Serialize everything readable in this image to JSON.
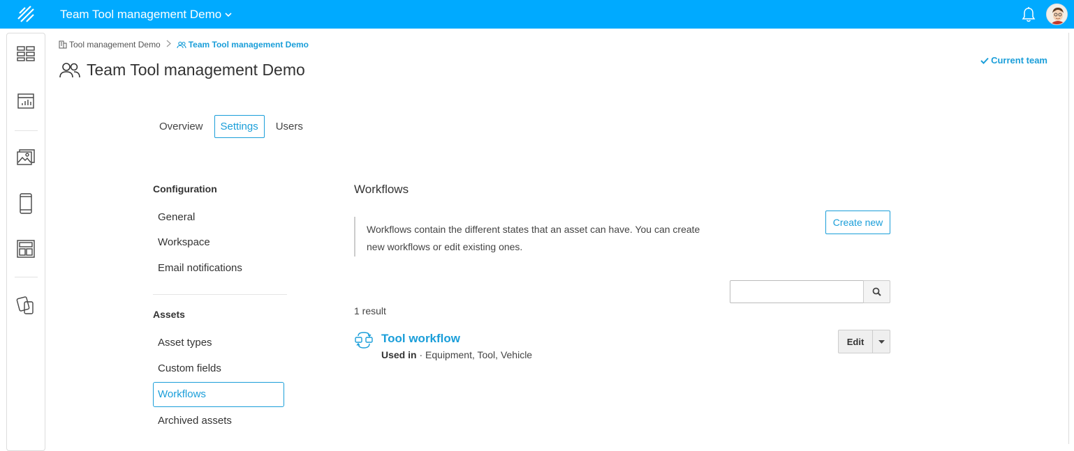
{
  "topbar": {
    "title": "Team Tool management Demo",
    "title_chevron": "⌄",
    "icons": [
      "logo-icon",
      "bell-icon",
      "avatar"
    ]
  },
  "breadcrumb": {
    "items": [
      {
        "label": "Tool management Demo",
        "icon": "building-icon"
      },
      {
        "label": "Team Tool management Demo",
        "icon": "team-icon"
      }
    ]
  },
  "page": {
    "title": "Team Tool management Demo",
    "current_team": "Current team"
  },
  "tabs": [
    {
      "label": "Overview",
      "active": false
    },
    {
      "label": "Settings",
      "active": true
    },
    {
      "label": "Users",
      "active": false
    }
  ],
  "menu": {
    "configuration_heading": "Configuration",
    "configuration_items": [
      {
        "label": "General"
      },
      {
        "label": "Workspace"
      },
      {
        "label": "Email notifications"
      }
    ],
    "assets_heading": "Assets",
    "assets_items": [
      {
        "label": "Asset types"
      },
      {
        "label": "Custom fields"
      },
      {
        "label": "Workflows",
        "active": true
      },
      {
        "label": "Archived assets"
      }
    ]
  },
  "content": {
    "title": "Workflows",
    "description_line1": "Workflows contain the different states that an asset can have. You can create",
    "description_line2": "new workflows or edit existing ones.",
    "create_button": "Create new",
    "search": {
      "value": "",
      "placeholder": ""
    },
    "result_count": "1 result",
    "workflows": [
      {
        "name": "Tool workflow",
        "used_in_label": "Used in",
        "used_in_separator": " · ",
        "used_in_value": "Equipment, Tool, Vehicle",
        "edit_label": "Edit"
      }
    ]
  },
  "colors": {
    "topbar": "#00aaff",
    "accent": "#1a9ed9"
  }
}
